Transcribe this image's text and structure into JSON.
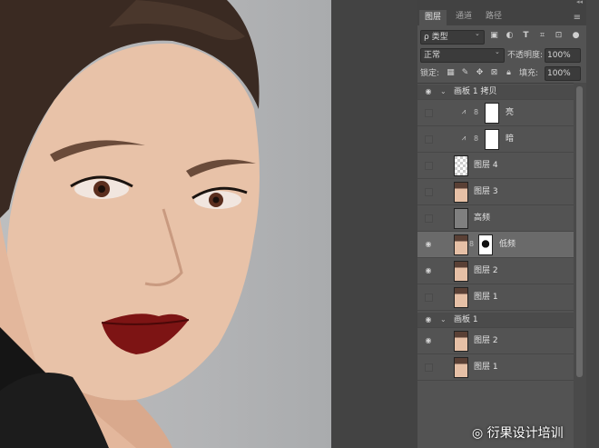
{
  "tabs": [
    "图层",
    "通道",
    "路径"
  ],
  "filter": {
    "label": "ρ 类型",
    "icons": [
      "image-filter-icon",
      "adjustment-filter-icon",
      "type-filter-icon",
      "shape-filter-icon",
      "smart-object-filter-icon"
    ]
  },
  "blend": {
    "mode": "正常",
    "opacity_label": "不透明度:",
    "opacity": "100%"
  },
  "lock": {
    "label": "锁定:",
    "fill_label": "填充:",
    "fill": "100%"
  },
  "layers": [
    {
      "kind": "group",
      "name": "画板 1 拷贝",
      "visible": true
    },
    {
      "kind": "adjust",
      "name": "亮",
      "visible": false
    },
    {
      "kind": "adjust",
      "name": "暗",
      "visible": false
    },
    {
      "kind": "layer",
      "name": "图层 4",
      "visible": false,
      "thumb": "checker"
    },
    {
      "kind": "layer",
      "name": "图层 3",
      "visible": false,
      "thumb": "face"
    },
    {
      "kind": "layer",
      "name": "高频",
      "visible": false,
      "thumb": "gray"
    },
    {
      "kind": "masked",
      "name": "低频",
      "visible": true,
      "thumb": "face",
      "selected": true
    },
    {
      "kind": "layer",
      "name": "图层 2",
      "visible": true,
      "thumb": "face"
    },
    {
      "kind": "layer",
      "name": "图层 1",
      "visible": false,
      "thumb": "face"
    },
    {
      "kind": "group",
      "name": "画板 1",
      "visible": true
    },
    {
      "kind": "layer",
      "name": "图层 2",
      "visible": true,
      "thumb": "face"
    },
    {
      "kind": "layer",
      "name": "图层 1",
      "visible": false,
      "thumb": "face"
    }
  ],
  "watermark": "衍果设计培训",
  "colors": {
    "panel": "#535353",
    "selected": "#6a6a6a",
    "lip": "#7d1414"
  }
}
